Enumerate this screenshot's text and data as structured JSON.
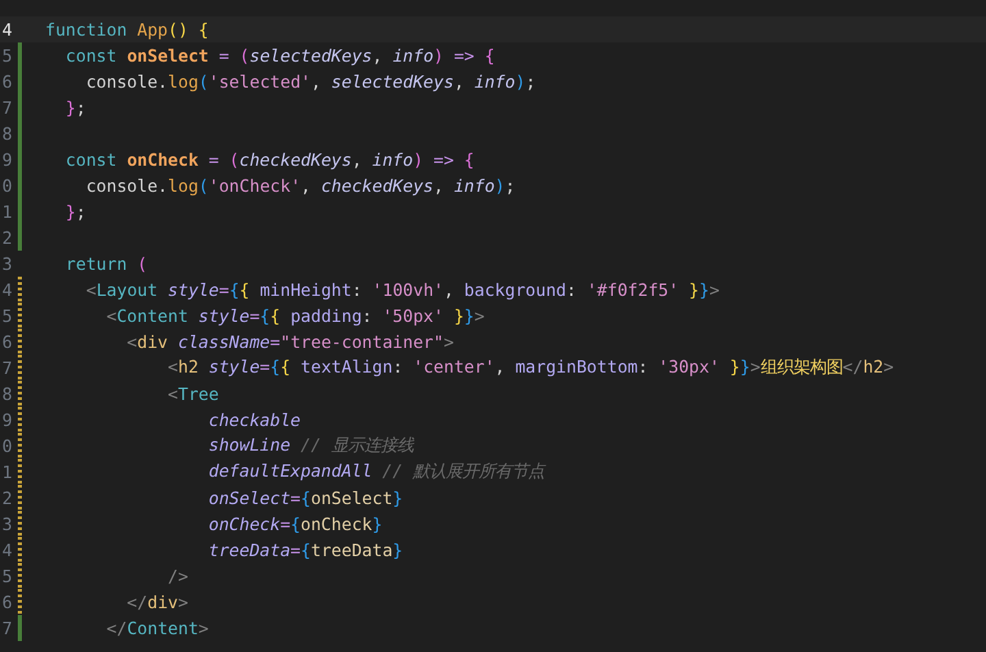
{
  "lines": [
    {
      "number": "4",
      "current": true,
      "added": false,
      "modified": false,
      "tokens": [
        {
          "text": "function ",
          "kind": "kw"
        },
        {
          "text": "App",
          "kind": "fn"
        },
        {
          "text": "() {",
          "kind": "p1"
        }
      ]
    },
    {
      "number": "5",
      "current": false,
      "added": true,
      "modified": false,
      "tokens": [
        {
          "text": "  const ",
          "kind": "kw"
        },
        {
          "text": "onSelect",
          "kind": "fnb"
        },
        {
          "text": " = ",
          "kind": "op"
        },
        {
          "text": "(",
          "kind": "p2"
        },
        {
          "text": "selectedKeys",
          "kind": "param"
        },
        {
          "text": ", ",
          "kind": "punct"
        },
        {
          "text": "info",
          "kind": "param"
        },
        {
          "text": ")",
          "kind": "p2"
        },
        {
          "text": " => ",
          "kind": "op"
        },
        {
          "text": "{",
          "kind": "p2"
        }
      ]
    },
    {
      "number": "6",
      "current": false,
      "added": true,
      "modified": false,
      "tokens": [
        {
          "text": "    console.",
          "kind": "var"
        },
        {
          "text": "log",
          "kind": "method"
        },
        {
          "text": "(",
          "kind": "p3"
        },
        {
          "text": "'selected'",
          "kind": "str"
        },
        {
          "text": ", ",
          "kind": "punct"
        },
        {
          "text": "selectedKeys",
          "kind": "param"
        },
        {
          "text": ", ",
          "kind": "punct"
        },
        {
          "text": "info",
          "kind": "param"
        },
        {
          "text": ")",
          "kind": "p3"
        },
        {
          "text": ";",
          "kind": "punct"
        }
      ]
    },
    {
      "number": "7",
      "current": false,
      "added": true,
      "modified": false,
      "tokens": [
        {
          "text": "  }",
          "kind": "p2"
        },
        {
          "text": ";",
          "kind": "punct"
        }
      ]
    },
    {
      "number": "8",
      "current": false,
      "added": true,
      "modified": false
    },
    {
      "number": "9",
      "current": false,
      "added": true,
      "modified": false,
      "tokens": [
        {
          "text": "  const ",
          "kind": "kw"
        },
        {
          "text": "onCheck",
          "kind": "fnb"
        },
        {
          "text": " = ",
          "kind": "op"
        },
        {
          "text": "(",
          "kind": "p2"
        },
        {
          "text": "checkedKeys",
          "kind": "param"
        },
        {
          "text": ", ",
          "kind": "punct"
        },
        {
          "text": "info",
          "kind": "param"
        },
        {
          "text": ")",
          "kind": "p2"
        },
        {
          "text": " => ",
          "kind": "op"
        },
        {
          "text": "{",
          "kind": "p2"
        }
      ]
    },
    {
      "number": "0",
      "current": false,
      "added": true,
      "modified": false,
      "tokens": [
        {
          "text": "    console.",
          "kind": "var"
        },
        {
          "text": "log",
          "kind": "method"
        },
        {
          "text": "(",
          "kind": "p3"
        },
        {
          "text": "'onCheck'",
          "kind": "str"
        },
        {
          "text": ", ",
          "kind": "punct"
        },
        {
          "text": "checkedKeys",
          "kind": "param"
        },
        {
          "text": ", ",
          "kind": "punct"
        },
        {
          "text": "info",
          "kind": "param"
        },
        {
          "text": ")",
          "kind": "p3"
        },
        {
          "text": ";",
          "kind": "punct"
        }
      ]
    },
    {
      "number": "1",
      "current": false,
      "added": true,
      "modified": false,
      "tokens": [
        {
          "text": "  }",
          "kind": "p2"
        },
        {
          "text": ";",
          "kind": "punct"
        }
      ]
    },
    {
      "number": "2",
      "current": false,
      "added": true,
      "modified": false
    },
    {
      "number": "3",
      "current": false,
      "added": false,
      "modified": false,
      "tokens": [
        {
          "text": "  return ",
          "kind": "kw"
        },
        {
          "text": "(",
          "kind": "p2"
        }
      ]
    },
    {
      "number": "4",
      "current": false,
      "added": false,
      "modified": true,
      "tokens": [
        {
          "text": "    <",
          "kind": "angle"
        },
        {
          "text": "Layout",
          "kind": "ctag"
        },
        {
          "text": " style",
          "kind": "attr"
        },
        {
          "text": "=",
          "kind": "op"
        },
        {
          "text": "{",
          "kind": "p3"
        },
        {
          "text": "{",
          "kind": "p1"
        },
        {
          "text": " minHeight",
          "kind": "key"
        },
        {
          "text": ": ",
          "kind": "punct"
        },
        {
          "text": "'100vh'",
          "kind": "str"
        },
        {
          "text": ", ",
          "kind": "punct"
        },
        {
          "text": "background",
          "kind": "key"
        },
        {
          "text": ": ",
          "kind": "punct"
        },
        {
          "text": "'#f0f2f5'",
          "kind": "str"
        },
        {
          "text": " }",
          "kind": "p1"
        },
        {
          "text": "}",
          "kind": "p3"
        },
        {
          "text": ">",
          "kind": "angle"
        }
      ]
    },
    {
      "number": "5",
      "current": false,
      "added": false,
      "modified": true,
      "tokens": [
        {
          "text": "      <",
          "kind": "angle"
        },
        {
          "text": "Content",
          "kind": "ctag"
        },
        {
          "text": " style",
          "kind": "attr"
        },
        {
          "text": "=",
          "kind": "op"
        },
        {
          "text": "{",
          "kind": "p3"
        },
        {
          "text": "{",
          "kind": "p1"
        },
        {
          "text": " padding",
          "kind": "key"
        },
        {
          "text": ": ",
          "kind": "punct"
        },
        {
          "text": "'50px'",
          "kind": "str"
        },
        {
          "text": " }",
          "kind": "p1"
        },
        {
          "text": "}",
          "kind": "p3"
        },
        {
          "text": ">",
          "kind": "angle"
        }
      ]
    },
    {
      "number": "6",
      "current": false,
      "added": false,
      "modified": true,
      "tokens": [
        {
          "text": "        <",
          "kind": "angle"
        },
        {
          "text": "div",
          "kind": "htag"
        },
        {
          "text": " className",
          "kind": "attr"
        },
        {
          "text": "=",
          "kind": "op"
        },
        {
          "text": "\"tree-container\"",
          "kind": "str"
        },
        {
          "text": ">",
          "kind": "angle"
        }
      ]
    },
    {
      "number": "7",
      "current": false,
      "added": false,
      "modified": true,
      "tokens": [
        {
          "text": "            <",
          "kind": "angle"
        },
        {
          "text": "h2",
          "kind": "htag"
        },
        {
          "text": " style",
          "kind": "attr"
        },
        {
          "text": "=",
          "kind": "op"
        },
        {
          "text": "{",
          "kind": "p3"
        },
        {
          "text": "{",
          "kind": "p1"
        },
        {
          "text": " textAlign",
          "kind": "key"
        },
        {
          "text": ": ",
          "kind": "punct"
        },
        {
          "text": "'center'",
          "kind": "str"
        },
        {
          "text": ", ",
          "kind": "punct"
        },
        {
          "text": "marginBottom",
          "kind": "key"
        },
        {
          "text": ": ",
          "kind": "punct"
        },
        {
          "text": "'30px'",
          "kind": "str"
        },
        {
          "text": " }",
          "kind": "p1"
        },
        {
          "text": "}",
          "kind": "p3"
        },
        {
          "text": ">",
          "kind": "angle"
        },
        {
          "text": "组织架构图",
          "kind": "jsx"
        },
        {
          "text": "</",
          "kind": "angle"
        },
        {
          "text": "h2",
          "kind": "htag"
        },
        {
          "text": ">",
          "kind": "angle"
        }
      ]
    },
    {
      "number": "8",
      "current": false,
      "added": false,
      "modified": true,
      "tokens": [
        {
          "text": "            <",
          "kind": "angle"
        },
        {
          "text": "Tree",
          "kind": "ctag"
        }
      ]
    },
    {
      "number": "9",
      "current": false,
      "added": false,
      "modified": true,
      "tokens": [
        {
          "text": "                checkable",
          "kind": "attr"
        }
      ]
    },
    {
      "number": "0",
      "current": false,
      "added": false,
      "modified": true,
      "tokens": [
        {
          "text": "                showLine",
          "kind": "attr"
        },
        {
          "text": " // 显示连接线",
          "kind": "cmt"
        }
      ]
    },
    {
      "number": "1",
      "current": false,
      "added": false,
      "modified": true,
      "tokens": [
        {
          "text": "                defaultExpandAll",
          "kind": "attr"
        },
        {
          "text": " // 默认展开所有节点",
          "kind": "cmt"
        }
      ]
    },
    {
      "number": "2",
      "current": false,
      "added": false,
      "modified": true,
      "tokens": [
        {
          "text": "                onSelect",
          "kind": "attr"
        },
        {
          "text": "=",
          "kind": "op"
        },
        {
          "text": "{",
          "kind": "p3"
        },
        {
          "text": "onSelect",
          "kind": "ref"
        },
        {
          "text": "}",
          "kind": "p3"
        }
      ]
    },
    {
      "number": "3",
      "current": false,
      "added": false,
      "modified": true,
      "tokens": [
        {
          "text": "                onCheck",
          "kind": "attr"
        },
        {
          "text": "=",
          "kind": "op"
        },
        {
          "text": "{",
          "kind": "p3"
        },
        {
          "text": "onCheck",
          "kind": "ref"
        },
        {
          "text": "}",
          "kind": "p3"
        }
      ]
    },
    {
      "number": "4",
      "current": false,
      "added": false,
      "modified": true,
      "tokens": [
        {
          "text": "                treeData",
          "kind": "attr"
        },
        {
          "text": "=",
          "kind": "op"
        },
        {
          "text": "{",
          "kind": "p3"
        },
        {
          "text": "treeData",
          "kind": "ref"
        },
        {
          "text": "}",
          "kind": "p3"
        }
      ]
    },
    {
      "number": "5",
      "current": false,
      "added": false,
      "modified": true,
      "tokens": [
        {
          "text": "            />",
          "kind": "angle"
        }
      ]
    },
    {
      "number": "6",
      "current": false,
      "added": false,
      "modified": true,
      "tokens": [
        {
          "text": "        </",
          "kind": "angle"
        },
        {
          "text": "div",
          "kind": "htag"
        },
        {
          "text": ">",
          "kind": "angle"
        }
      ]
    },
    {
      "number": "7",
      "current": false,
      "added": true,
      "modified": false,
      "tokens": [
        {
          "text": "      </",
          "kind": "angle"
        },
        {
          "text": "Content",
          "kind": "ctag"
        },
        {
          "text": ">",
          "kind": "angle"
        }
      ]
    }
  ]
}
